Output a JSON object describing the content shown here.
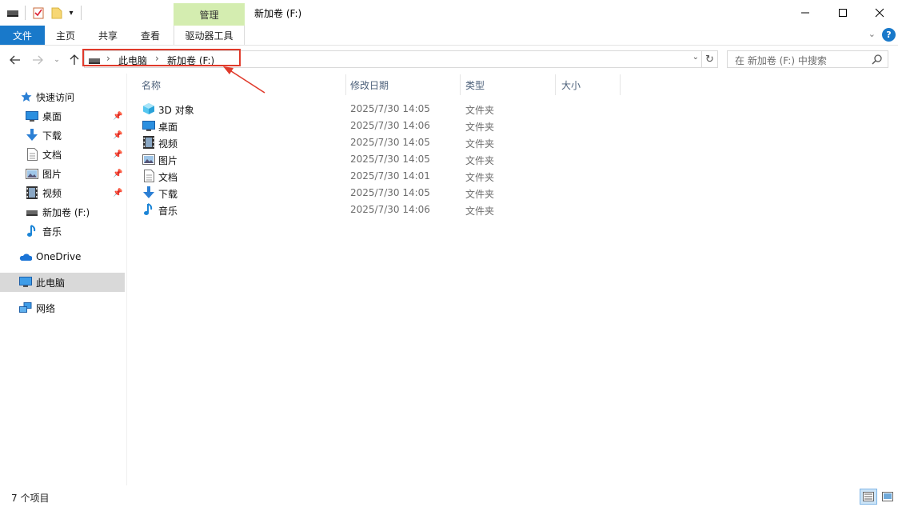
{
  "window": {
    "title": "新加卷 (F:)",
    "contextual_tab": "管理",
    "controls": {
      "minimize": "—",
      "maximize": "☐",
      "close": "✕"
    }
  },
  "ribbon": {
    "tabs": [
      "文件",
      "主页",
      "共享",
      "查看",
      "驱动器工具"
    ],
    "help": "?"
  },
  "address": {
    "segments": [
      "此电脑",
      "新加卷 (F:)"
    ],
    "separator": "›",
    "search_placeholder": "在 新加卷 (F:) 中搜索"
  },
  "sidebar": {
    "quick_access": "快速访问",
    "quick_items": [
      "桌面",
      "下载",
      "文档",
      "图片",
      "视频",
      "新加卷 (F:)",
      "音乐"
    ],
    "onedrive": "OneDrive",
    "this_pc": "此电脑",
    "network": "网络"
  },
  "columns": {
    "name": "名称",
    "date": "修改日期",
    "type": "类型",
    "size": "大小"
  },
  "files": [
    {
      "name": "3D 对象",
      "date": "2025/7/30 14:05",
      "type": "文件夹",
      "icon": "3d-objects-icon"
    },
    {
      "name": "桌面",
      "date": "2025/7/30 14:06",
      "type": "文件夹",
      "icon": "desktop-icon"
    },
    {
      "name": "视频",
      "date": "2025/7/30 14:05",
      "type": "文件夹",
      "icon": "video-icon"
    },
    {
      "name": "图片",
      "date": "2025/7/30 14:05",
      "type": "文件夹",
      "icon": "pictures-icon"
    },
    {
      "name": "文档",
      "date": "2025/7/30 14:01",
      "type": "文件夹",
      "icon": "documents-icon"
    },
    {
      "name": "下载",
      "date": "2025/7/30 14:05",
      "type": "文件夹",
      "icon": "downloads-icon"
    },
    {
      "name": "音乐",
      "date": "2025/7/30 14:06",
      "type": "文件夹",
      "icon": "music-icon"
    }
  ],
  "status": {
    "item_count": "7 个项目"
  },
  "colors": {
    "accent": "#1979ca",
    "manage_tab": "#d4edb0",
    "annotation": "#e03a2b",
    "selected": "#d9d9d9"
  }
}
